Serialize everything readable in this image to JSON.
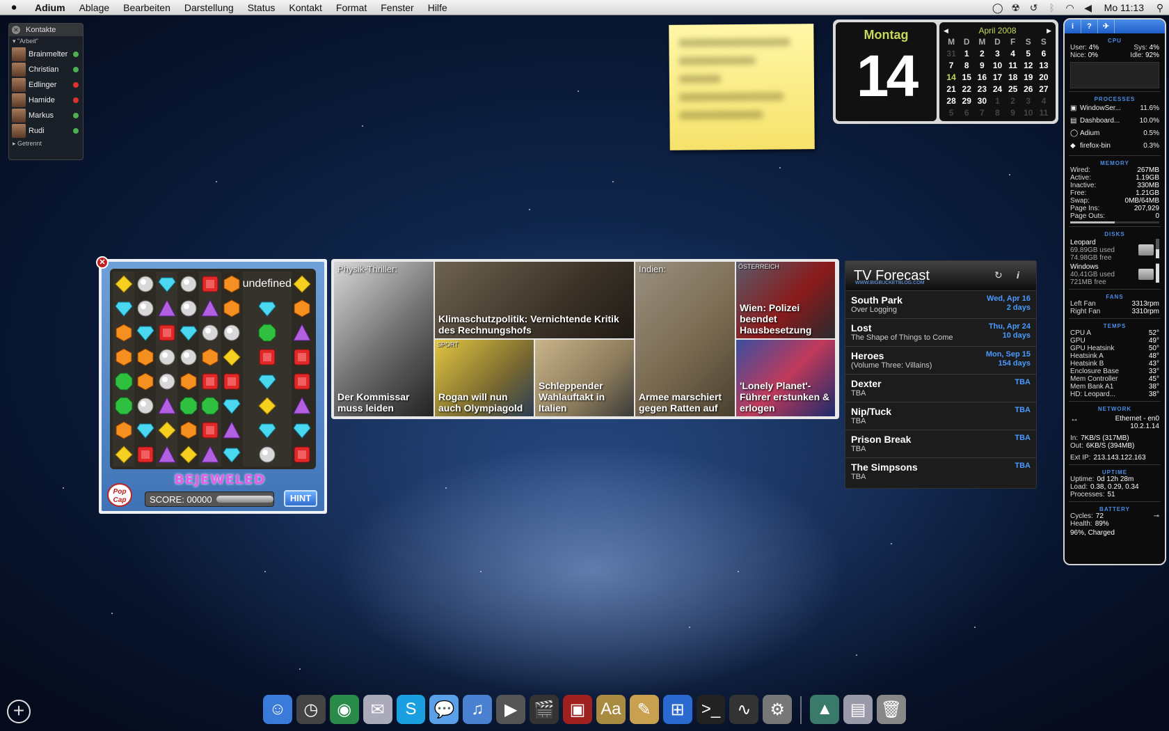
{
  "menubar": {
    "app": "Adium",
    "items": [
      "Ablage",
      "Bearbeiten",
      "Darstellung",
      "Status",
      "Kontakt",
      "Format",
      "Fenster",
      "Hilfe"
    ],
    "clock": "Mo 11:13"
  },
  "adium": {
    "title": "Kontakte",
    "group": "\"Arbeit\"",
    "contacts": [
      {
        "name": "Brainmelter",
        "status": "#4caf50"
      },
      {
        "name": "Christian",
        "status": "#4caf50"
      },
      {
        "name": "Edlinger",
        "status": "#e03030"
      },
      {
        "name": "Hamide",
        "status": "#e03030"
      },
      {
        "name": "Markus",
        "status": "#4caf50"
      },
      {
        "name": "Rudi",
        "status": "#4caf50"
      }
    ],
    "offline_group": "Getrennt"
  },
  "calendar": {
    "weekday": "Montag",
    "day": "14",
    "month": "April 2008",
    "headers": [
      "M",
      "D",
      "M",
      "D",
      "F",
      "S",
      "S"
    ],
    "days": [
      [
        "31",
        "dim"
      ],
      [
        "1",
        ""
      ],
      [
        "2",
        ""
      ],
      [
        "3",
        ""
      ],
      [
        "4",
        ""
      ],
      [
        "5",
        ""
      ],
      [
        "6",
        ""
      ],
      [
        "7",
        ""
      ],
      [
        "8",
        ""
      ],
      [
        "9",
        ""
      ],
      [
        "10",
        ""
      ],
      [
        "11",
        ""
      ],
      [
        "12",
        ""
      ],
      [
        "13",
        ""
      ],
      [
        "14",
        "today"
      ],
      [
        "15",
        ""
      ],
      [
        "16",
        ""
      ],
      [
        "17",
        ""
      ],
      [
        "18",
        ""
      ],
      [
        "19",
        ""
      ],
      [
        "20",
        ""
      ],
      [
        "21",
        ""
      ],
      [
        "22",
        ""
      ],
      [
        "23",
        ""
      ],
      [
        "24",
        ""
      ],
      [
        "25",
        ""
      ],
      [
        "26",
        ""
      ],
      [
        "27",
        ""
      ],
      [
        "28",
        ""
      ],
      [
        "29",
        ""
      ],
      [
        "30",
        ""
      ],
      [
        "1",
        "dim"
      ],
      [
        "2",
        "dim"
      ],
      [
        "3",
        "dim"
      ],
      [
        "4",
        "dim"
      ],
      [
        "5",
        "dim"
      ],
      [
        "6",
        "dim"
      ],
      [
        "7",
        "dim"
      ],
      [
        "8",
        "dim"
      ],
      [
        "9",
        "dim"
      ],
      [
        "10",
        "dim"
      ],
      [
        "11",
        "dim"
      ]
    ]
  },
  "istat": {
    "cpu_title": "CPU",
    "cpu": {
      "user_label": "User:",
      "user": "4%",
      "sys_label": "Sys:",
      "sys": "4%",
      "nice_label": "Nice:",
      "nice": "0%",
      "idle_label": "Idle:",
      "idle": "92%"
    },
    "processes_title": "PROCESSES",
    "processes": [
      {
        "name": "WindowSer...",
        "value": "11.6%"
      },
      {
        "name": "Dashboard...",
        "value": "10.0%"
      },
      {
        "name": "Adium",
        "value": "0.5%"
      },
      {
        "name": "firefox-bin",
        "value": "0.3%"
      }
    ],
    "memory_title": "MEMORY",
    "memory": [
      {
        "label": "Wired:",
        "value": "267MB"
      },
      {
        "label": "Active:",
        "value": "1.19GB"
      },
      {
        "label": "Inactive:",
        "value": "330MB"
      },
      {
        "label": "Free:",
        "value": "1.21GB"
      },
      {
        "label": "Swap:",
        "value": "0MB/64MB"
      },
      {
        "label": "Page Ins:",
        "value": "207,929"
      },
      {
        "label": "Page Outs:",
        "value": "0"
      }
    ],
    "memory_used_fraction": 0.5,
    "disks_title": "DISKS",
    "disks": [
      {
        "name": "Leopard",
        "used": "69.89GB used",
        "free": "74.98GB free",
        "fill": 0.48
      },
      {
        "name": "Windows",
        "used": "40.41GB used",
        "free": "721MB free",
        "fill": 0.98
      }
    ],
    "fans_title": "FANS",
    "fans": [
      {
        "label": "Left Fan",
        "value": "3313rpm"
      },
      {
        "label": "Right Fan",
        "value": "3310rpm"
      }
    ],
    "temps_title": "TEMPS",
    "temps": [
      {
        "label": "CPU A",
        "value": "52°"
      },
      {
        "label": "GPU",
        "value": "49°"
      },
      {
        "label": "GPU Heatsink",
        "value": "50°"
      },
      {
        "label": "Heatsink A",
        "value": "48°"
      },
      {
        "label": "Heatsink B",
        "value": "43°"
      },
      {
        "label": "Enclosure Base",
        "value": "33°"
      },
      {
        "label": "Mem Controller",
        "value": "45°"
      },
      {
        "label": "Mem Bank A1",
        "value": "38°"
      },
      {
        "label": "HD: Leopard...",
        "value": "38°"
      }
    ],
    "network_title": "NETWORK",
    "network": {
      "iface": "Ethernet - en0",
      "ip": "10.2.1.14",
      "in_label": "In:",
      "in": "7KB/S (317MB)",
      "out_label": "Out:",
      "out": "6KB/S (394MB)",
      "ext_label": "Ext IP:",
      "ext": "213.143.122.163"
    },
    "uptime_title": "UPTIME",
    "uptime": {
      "uptime_label": "Uptime:",
      "uptime": "0d 12h 28m",
      "load_label": "Load:",
      "load": "0.38, 0.29, 0.34",
      "procs_label": "Processes:",
      "procs": "51"
    },
    "battery_title": "BATTERY",
    "battery": {
      "cycles_label": "Cycles:",
      "cycles": "72",
      "health_label": "Health:",
      "health": "89%",
      "status": "96%, Charged"
    }
  },
  "bejeweled": {
    "title": "BEJEWELED",
    "popcap": "Pop Cap",
    "score_label": "SCORE:",
    "score": "00000",
    "hint": "HINT",
    "board": [
      "YWBWRODY",
      "BWPWPOBO",
      "OBRBWWGP",
      "OOWWOYRR",
      "GOWORRBR",
      "GWPGGBYP",
      "OBYORPBB",
      "YRPYPBWR"
    ]
  },
  "news": {
    "tiles": [
      {
        "kicker": "Physik-Thriller:",
        "tag": "",
        "caption": "Der Kommissar muss leiden",
        "bg": "linear-gradient(135deg,#d8d8d8,#6a6a6a 55%,#222)"
      },
      {
        "kicker": "",
        "tag": "",
        "caption": "Klimaschutzpolitik: Vernichtende Kritik des Rechnungshofs",
        "bg": "linear-gradient(135deg,#6e6250,#3c3328 60%,#1f1a14)"
      },
      {
        "kicker": "",
        "tag": "SPORT",
        "caption": "Rogan will nun auch Olympiagold",
        "bg": "linear-gradient(135deg,#e2c640,#7a6a30 60%,#2a3c55)"
      },
      {
        "kicker": "",
        "tag": "",
        "caption": "Schleppender Wahlauftakt in Italien",
        "bg": "linear-gradient(135deg,#c9b48a,#8a7a5a 60%,#3a3a3a)"
      },
      {
        "kicker": "Indien:",
        "tag": "",
        "caption": "Armee marschiert gegen Ratten auf",
        "bg": "linear-gradient(135deg,#9a9080,#7a6a50 55%,#4a4030)"
      },
      {
        "kicker": "",
        "tag": "ÖSTERREICH",
        "caption": "Wien: Polizei beendet Hausbesetzung",
        "bg": "linear-gradient(135deg,#5a5a6a,#8a1a1a 55%,#2a2a30)"
      },
      {
        "kicker": "",
        "tag": "",
        "caption": "'Lonely Planet'-Führer erstunken & erlogen",
        "bg": "linear-gradient(135deg,#3a4ea0,#c03a5a 50%,#1a2a6a)"
      }
    ]
  },
  "tv": {
    "title": "TV Forecast",
    "url": "WWW.BIGBUCKETBLOG.COM",
    "shows": [
      {
        "name": "South Park",
        "episode": "Over Logging",
        "date": "Wed, Apr 16",
        "eta": "2 days"
      },
      {
        "name": "Lost",
        "episode": "The Shape of Things to Come",
        "date": "Thu, Apr 24",
        "eta": "10 days"
      },
      {
        "name": "Heroes",
        "episode": "(Volume Three: Villains)",
        "date": "Mon, Sep 15",
        "eta": "154 days"
      },
      {
        "name": "Dexter",
        "episode": "TBA",
        "date": "TBA",
        "eta": ""
      },
      {
        "name": "Nip/Tuck",
        "episode": "TBA",
        "date": "TBA",
        "eta": ""
      },
      {
        "name": "Prison Break",
        "episode": "TBA",
        "date": "TBA",
        "eta": ""
      },
      {
        "name": "The Simpsons",
        "episode": "TBA",
        "date": "TBA",
        "eta": ""
      }
    ]
  },
  "dock": {
    "apps": [
      {
        "name": "finder-icon",
        "glyph": "☺",
        "bg": "#3a7ad8"
      },
      {
        "name": "dashboard-icon",
        "glyph": "◷",
        "bg": "#444"
      },
      {
        "name": "network-icon",
        "glyph": "◉",
        "bg": "#2a8a4a"
      },
      {
        "name": "mail-icon",
        "glyph": "✉",
        "bg": "#aab"
      },
      {
        "name": "skype-icon",
        "glyph": "S",
        "bg": "#1aa0e0"
      },
      {
        "name": "ichat-icon",
        "glyph": "💬",
        "bg": "#5aa0e8"
      },
      {
        "name": "itunes-icon",
        "glyph": "♫",
        "bg": "#4a80d0"
      },
      {
        "name": "imovie-icon",
        "glyph": "▶",
        "bg": "#555"
      },
      {
        "name": "clapper-icon",
        "glyph": "🎬",
        "bg": "#333"
      },
      {
        "name": "photo-app-icon",
        "glyph": "▣",
        "bg": "#a02020"
      },
      {
        "name": "dictionary-icon",
        "glyph": "Aa",
        "bg": "#a88a40"
      },
      {
        "name": "textedit-icon",
        "glyph": "✎",
        "bg": "#c8a050"
      },
      {
        "name": "windows-icon",
        "glyph": "⊞",
        "bg": "#2a6ad0"
      },
      {
        "name": "terminal-icon",
        "glyph": ">_",
        "bg": "#222"
      },
      {
        "name": "activity-monitor-icon",
        "glyph": "∿",
        "bg": "#333"
      },
      {
        "name": "system-preferences-icon",
        "glyph": "⚙",
        "bg": "#777"
      }
    ],
    "right": [
      {
        "name": "applications-stack-icon",
        "glyph": "▲",
        "bg": "#3a7a6a"
      },
      {
        "name": "documents-stack-icon",
        "glyph": "▤",
        "bg": "#99a"
      },
      {
        "name": "trash-icon",
        "glyph": "🗑",
        "bg": "#888"
      }
    ]
  }
}
